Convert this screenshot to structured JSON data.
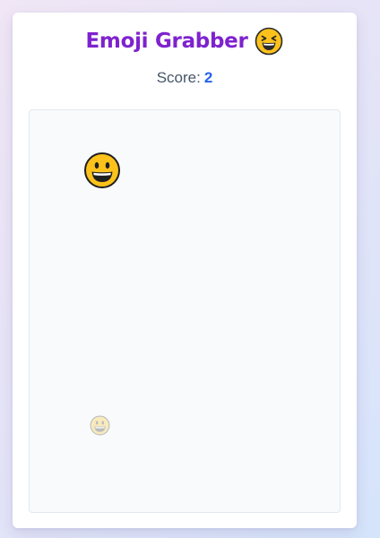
{
  "header": {
    "title": "Emoji Grabber",
    "title_icon": "laughing-squinting-face-emoji"
  },
  "score": {
    "label": "Score:",
    "value": "2"
  },
  "play_area": {
    "active_emoji": "grinning-face-emoji",
    "faded_emoji": "grinning-face-emoji"
  },
  "colors": {
    "title": "#7e22ce",
    "score_value": "#2563eb",
    "score_label": "#475569",
    "play_area_bg": "#f8fafc",
    "play_area_border": "#e2e8f0",
    "emoji_fill": "#fcc21b"
  }
}
